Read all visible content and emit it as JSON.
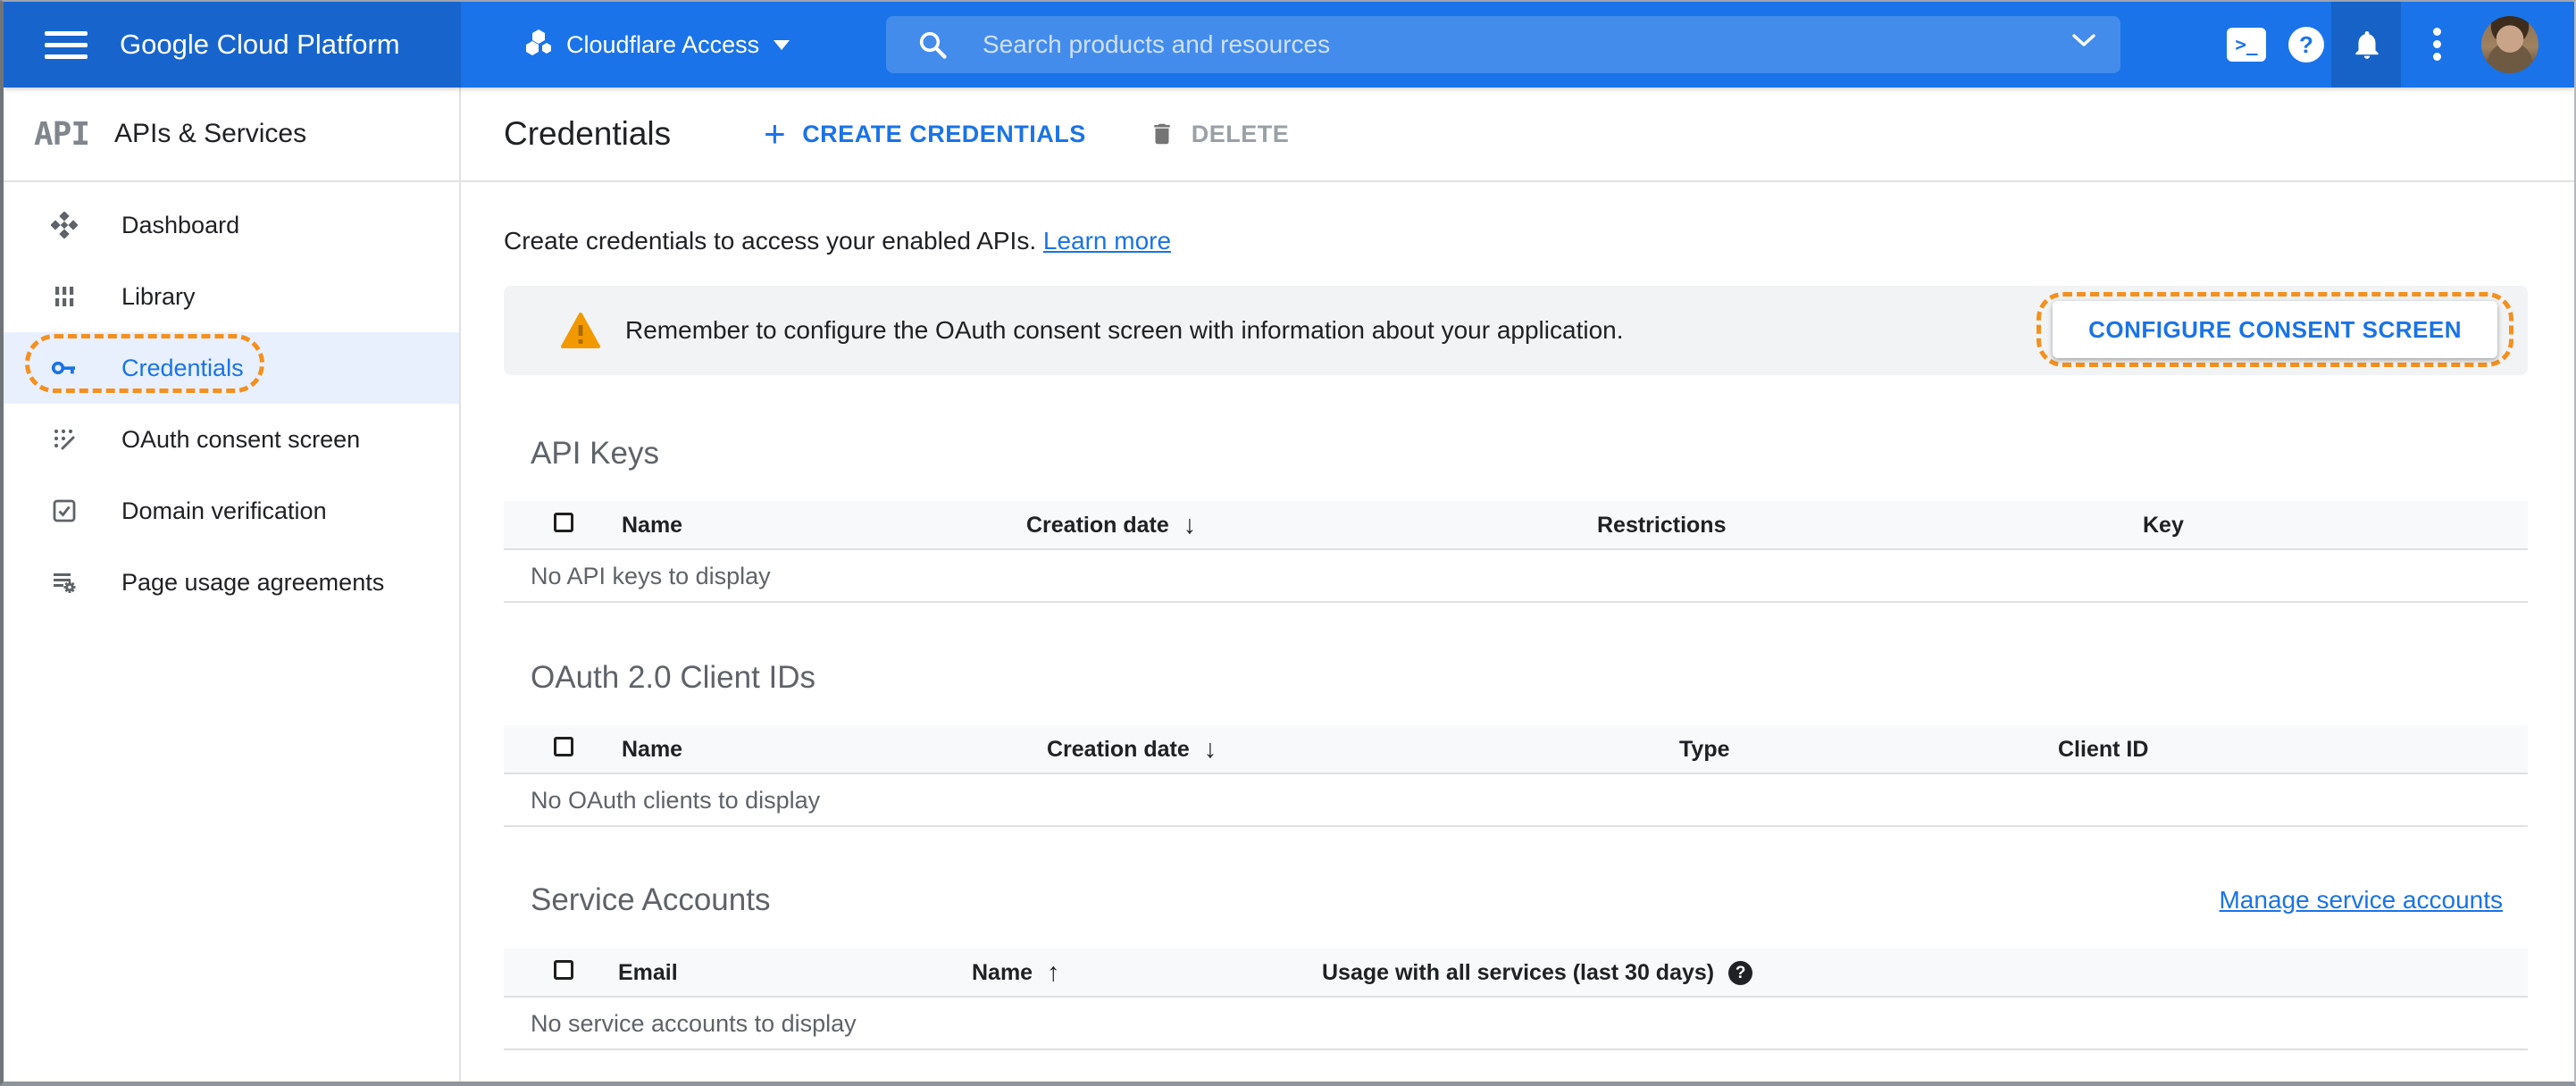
{
  "header": {
    "logo_text": "Google Cloud Platform",
    "project": {
      "name": "Cloudflare Access"
    },
    "search": {
      "placeholder": "Search products and resources"
    },
    "shell_glyph": ">_",
    "help_glyph": "?"
  },
  "sidebar": {
    "logo_text": "API",
    "title": "APIs & Services",
    "items": [
      {
        "label": "Dashboard"
      },
      {
        "label": "Library"
      },
      {
        "label": "Credentials"
      },
      {
        "label": "OAuth consent screen"
      },
      {
        "label": "Domain verification"
      },
      {
        "label": "Page usage agreements"
      }
    ]
  },
  "toolbar": {
    "title": "Credentials",
    "create_label": "CREATE CREDENTIALS",
    "delete_label": "DELETE"
  },
  "content": {
    "intro_text": "Create credentials to access your enabled APIs.",
    "learn_more_label": "Learn more",
    "banner": {
      "message": "Remember to configure the OAuth consent screen with information about your application.",
      "action_label": "CONFIGURE CONSENT SCREEN"
    },
    "sections": {
      "api_keys": {
        "title": "API Keys",
        "columns": [
          "Name",
          "Creation date",
          "Restrictions",
          "Key"
        ],
        "sort_column": "Creation date",
        "sort_direction": "desc",
        "empty_text": "No API keys to display"
      },
      "oauth_clients": {
        "title": "OAuth 2.0 Client IDs",
        "columns": [
          "Name",
          "Creation date",
          "Type",
          "Client ID"
        ],
        "sort_column": "Creation date",
        "sort_direction": "desc",
        "empty_text": "No OAuth clients to display"
      },
      "service_accounts": {
        "title": "Service Accounts",
        "manage_link_label": "Manage service accounts",
        "columns": [
          "Email",
          "Name",
          "Usage with all services (last 30 days)"
        ],
        "sort_column": "Name",
        "sort_direction": "asc",
        "empty_text": "No service accounts to display"
      }
    }
  },
  "glyphs": {
    "plus": "+",
    "sort_desc": "↓",
    "sort_asc": "↑",
    "help": "?"
  },
  "colors": {
    "header_blue": "#1a73e8",
    "header_dark_blue": "#1765cc",
    "accent_blue": "#1a73e8",
    "annotation_orange": "#f4901d",
    "warning_orange": "#f29900",
    "active_row_bg": "#e8f0fe",
    "banner_bg": "#f1f3f4",
    "table_head_bg": "#f8f9fa"
  }
}
